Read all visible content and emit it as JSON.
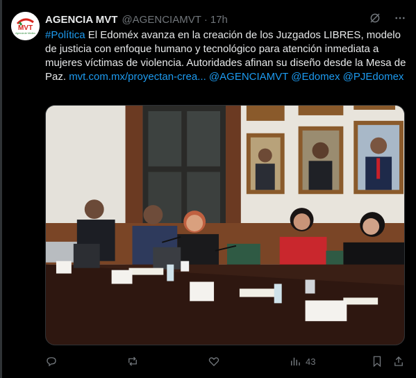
{
  "post": {
    "author_name": "AGENCIA MVT",
    "author_handle": "@AGENCIAMVT",
    "separator": "·",
    "time": "17h",
    "hashtag": "#Política",
    "body": " El Edoméx avanza en la creación de los Juzgados LIBRES, modelo de justicia con enfoque humano y tecnológico para atención inmediata a mujeres víctimas de violencia. Autoridades afinan su diseño desde la Mesa de Paz. ",
    "link": "mvt.com.mx/proyectan-crea...",
    "mention_1": "@AGENCIAMVT",
    "mention_2": "@Edomex",
    "mention_3": "@PJEdomex"
  },
  "avatar": {
    "logo_text": "MVT",
    "logo_subtext": "Agencia de Medios"
  },
  "photo": {
    "placard_1": "",
    "placard_2": "",
    "placard_3": ""
  },
  "actions": {
    "views_count": "43"
  },
  "icons": {
    "grok": "grok-icon",
    "more": "more-icon",
    "reply": "reply-icon",
    "repost": "repost-icon",
    "like": "like-icon",
    "views": "views-icon",
    "bookmark": "bookmark-icon",
    "share": "share-icon"
  },
  "colors": {
    "background": "#000000",
    "text": "#e7e9ea",
    "muted": "#71767b",
    "link": "#1d9bf0",
    "logo_red": "#d7261e",
    "logo_green": "#2e8b3a"
  }
}
